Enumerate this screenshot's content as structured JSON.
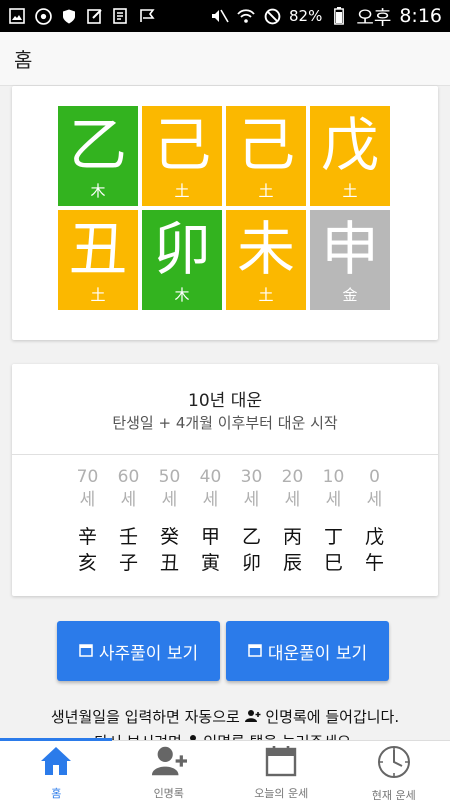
{
  "status_bar": {
    "battery": "82%",
    "ampm": "오후",
    "time": "8:16"
  },
  "app_bar": {
    "title": "홈"
  },
  "saju": {
    "top": [
      {
        "char": "乙",
        "element": "木",
        "color": "#33b31f"
      },
      {
        "char": "己",
        "element": "土",
        "color": "#fbb800"
      },
      {
        "char": "己",
        "element": "土",
        "color": "#fbb800"
      },
      {
        "char": "戊",
        "element": "土",
        "color": "#fbb800"
      }
    ],
    "bottom": [
      {
        "char": "丑",
        "element": "土",
        "color": "#fbb800"
      },
      {
        "char": "卯",
        "element": "木",
        "color": "#33b31f"
      },
      {
        "char": "未",
        "element": "土",
        "color": "#fbb800"
      },
      {
        "char": "申",
        "element": "金",
        "color": "#b8b8b8"
      }
    ]
  },
  "daeun": {
    "title": "10년 대운",
    "subtitle": "탄생일 + 4개월 이후부터 대운 시작",
    "columns": [
      {
        "age": "70",
        "unit": "세",
        "stem": "辛",
        "branch": "亥"
      },
      {
        "age": "60",
        "unit": "세",
        "stem": "壬",
        "branch": "子"
      },
      {
        "age": "50",
        "unit": "세",
        "stem": "癸",
        "branch": "丑"
      },
      {
        "age": "40",
        "unit": "세",
        "stem": "甲",
        "branch": "寅"
      },
      {
        "age": "30",
        "unit": "세",
        "stem": "乙",
        "branch": "卯"
      },
      {
        "age": "20",
        "unit": "세",
        "stem": "丙",
        "branch": "辰"
      },
      {
        "age": "10",
        "unit": "세",
        "stem": "丁",
        "branch": "巳"
      },
      {
        "age": "0",
        "unit": "세",
        "stem": "戊",
        "branch": "午"
      }
    ]
  },
  "buttons": {
    "saju": "사주풀이 보기",
    "daeun": "대운풀이 보기"
  },
  "notice": {
    "part1": "생년월일을 입력하면 자동으로",
    "part2": "인명록에 들어갑니다.",
    "line2a": "다시 보시려면",
    "line2b": "인명록 탭을 눌러주세요."
  },
  "nav": [
    {
      "label": "홈",
      "icon": "home-icon"
    },
    {
      "label": "인명록",
      "icon": "add-person-icon"
    },
    {
      "label": "오늘의 운세",
      "icon": "calendar-icon"
    },
    {
      "label": "현재 운세",
      "icon": "clock-icon"
    }
  ],
  "colors": {
    "accent": "#2b7bea",
    "wood": "#33b31f",
    "earth": "#fbb800",
    "metal": "#b8b8b8"
  }
}
